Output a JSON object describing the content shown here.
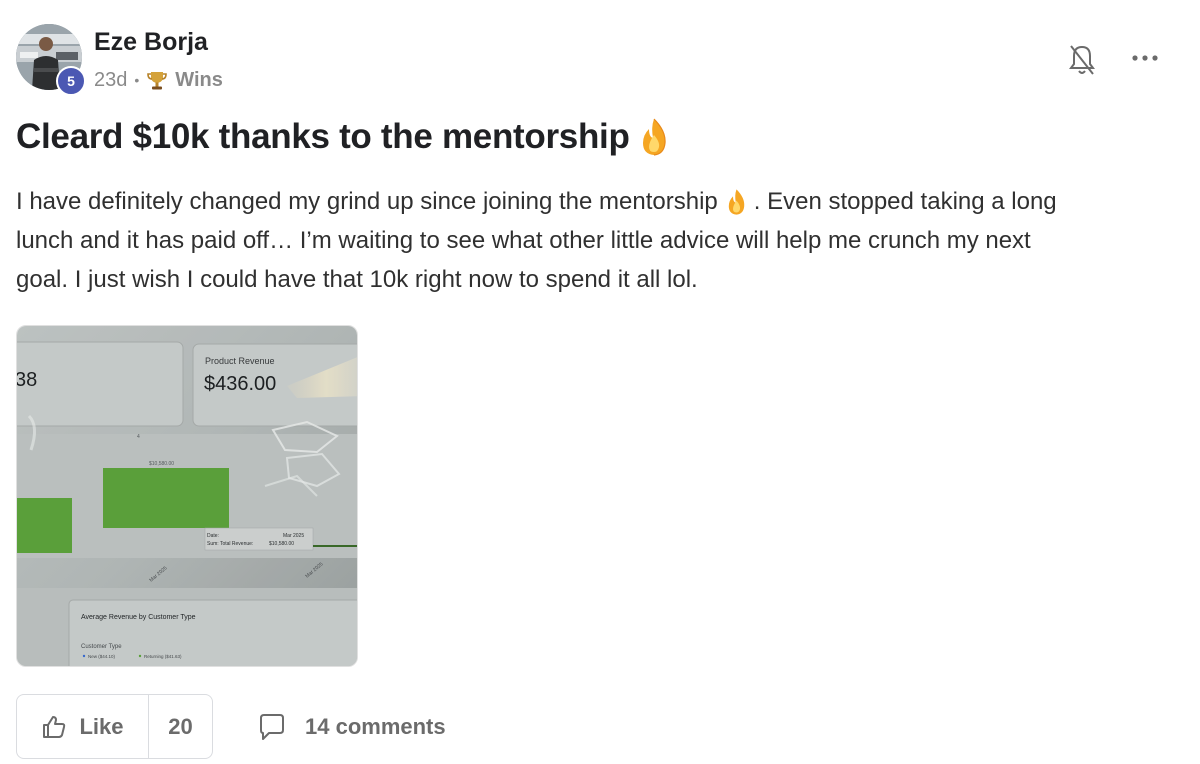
{
  "post": {
    "author": "Eze Borja",
    "level": "5",
    "time_ago": "23d",
    "separator": "•",
    "category": "Wins",
    "title": "Cleard $10k thanks to the mentorship",
    "body_lines": [
      "I have definitely changed my grind up since joining the mentorship",
      ". Even stopped taking a long",
      "lunch and it has paid off… I’m waiting to see what other little advice will help me crunch my next",
      "goal. I just wish I could have that 10k right now to spend it all lol."
    ]
  },
  "attachment": {
    "product_revenue_label": "Product Revenue",
    "product_revenue_value": "$436.00",
    "left_value": "38",
    "bar_label": "$10,580.00",
    "tooltip_date_label": "Date:",
    "tooltip_date_value": "Mar 2025",
    "tooltip_sum_label": "Sum: Total Revenue:",
    "tooltip_sum_value": "$10,580.00",
    "axis_label": "Mar 2025",
    "section_title": "Average Revenue by Customer Type",
    "legend_title": "Customer Type",
    "legend_new": "New ($44.10)",
    "legend_returning": "Returning ($41.63)"
  },
  "actions": {
    "like_label": "Like",
    "like_count": "20",
    "comments_label": "14 comments"
  },
  "colors": {
    "level_badge": "#4b58b3",
    "title_text": "#202124",
    "action_text": "#6b6b6b"
  },
  "icons": {
    "bell": "bell-off-icon",
    "more": "more-horizontal-icon",
    "like": "thumbs-up-icon",
    "comment": "comment-icon",
    "trophy": "trophy-icon",
    "fire": "fire-emoji"
  }
}
